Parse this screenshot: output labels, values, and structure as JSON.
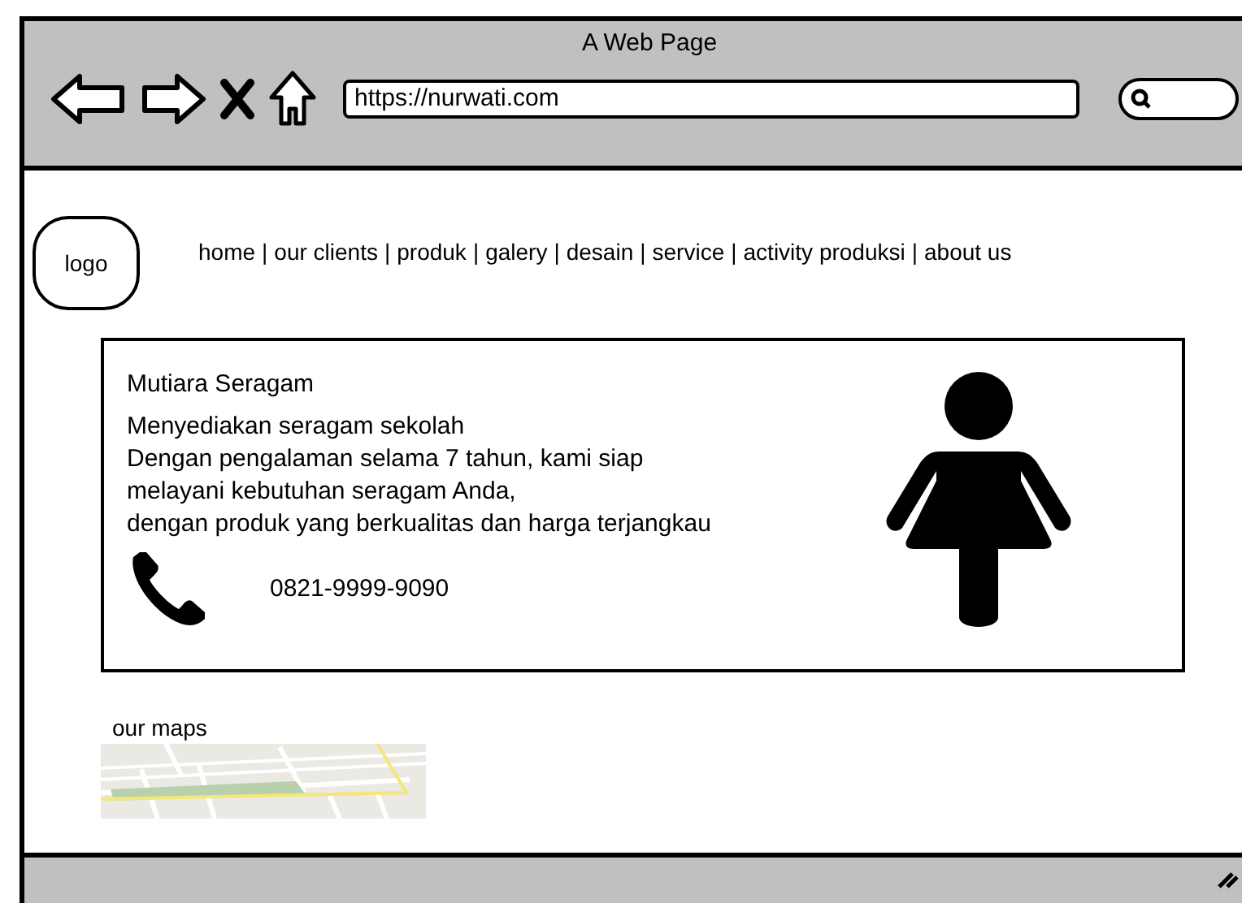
{
  "window": {
    "title": "A Web Page"
  },
  "address_bar": {
    "value": "https://nurwati.com"
  },
  "logo": {
    "label": "logo"
  },
  "nav": {
    "separator": "|",
    "items": [
      {
        "label": "home"
      },
      {
        "label": "our clients"
      },
      {
        "label": "produk"
      },
      {
        "label": "galery"
      },
      {
        "label": "desain"
      },
      {
        "label": "service"
      },
      {
        "label": "activity produksi"
      },
      {
        "label": "about us"
      }
    ]
  },
  "card": {
    "title": "Mutiara Seragam",
    "lines": [
      "Menyediakan seragam sekolah",
      "Dengan pengalaman selama 7 tahun, kami siap melayani kebutuhan seragam Anda,",
      "dengan produk yang berkualitas dan harga terjangkau"
    ],
    "phone": "0821-9999-9090"
  },
  "maps": {
    "label": "our maps",
    "kind": "picture"
  }
}
